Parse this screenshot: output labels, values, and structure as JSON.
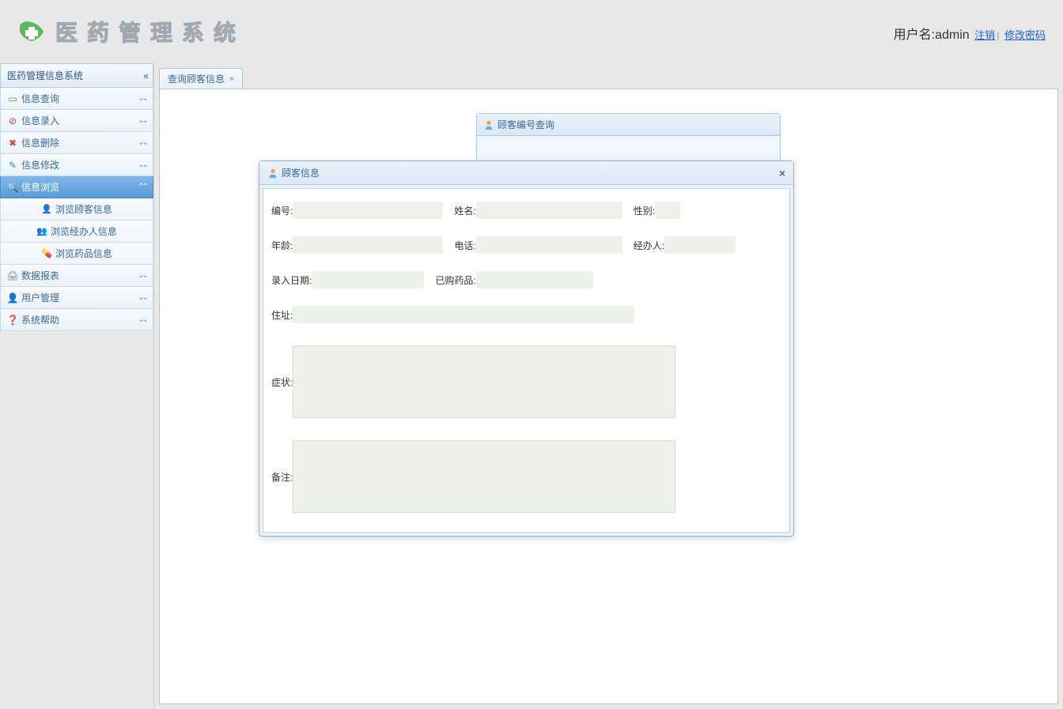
{
  "header": {
    "app_title": "医药管理系统",
    "user_label": "用户名:",
    "user_name": "admin",
    "logout": "注销",
    "change_pwd": "修改密码"
  },
  "sidebar": {
    "title": "医药管理信息系统",
    "items": [
      {
        "label": "信息查询",
        "icon_color": "#4c9e4c"
      },
      {
        "label": "信息录入",
        "icon_color": "#d04848"
      },
      {
        "label": "信息删除",
        "icon_color": "#d04848"
      },
      {
        "label": "信息修改",
        "icon_color": "#4080d0"
      },
      {
        "label": "信息浏览",
        "icon_color": "#ffffff"
      },
      {
        "label": "数据报表",
        "icon_color": "#888"
      },
      {
        "label": "用户管理",
        "icon_color": "#4080d0"
      },
      {
        "label": "系统帮助",
        "icon_color": "#4080d0"
      }
    ],
    "sub_items": [
      {
        "label": "浏览顾客信息"
      },
      {
        "label": "浏览经办人信息"
      },
      {
        "label": "浏览药品信息"
      }
    ]
  },
  "tab": {
    "label": "查询顾客信息"
  },
  "search_panel": {
    "title": "顾客编号查询"
  },
  "modal": {
    "title": "顾客信息",
    "fields": {
      "id_label": "编号:",
      "name_label": "姓名:",
      "gender_label": "性别:",
      "age_label": "年龄:",
      "phone_label": "电话:",
      "operator_label": "经办人:",
      "entry_date_label": "录入日期:",
      "purchased_label": "已购药品:",
      "address_label": "住址:",
      "symptom_label": "症状:",
      "remark_label": "备注:"
    },
    "values": {
      "id": "",
      "name": "",
      "gender": "",
      "age": "",
      "phone": "",
      "operator": "",
      "entry_date": "",
      "purchased": "",
      "address": "",
      "symptom": "",
      "remark": ""
    }
  }
}
